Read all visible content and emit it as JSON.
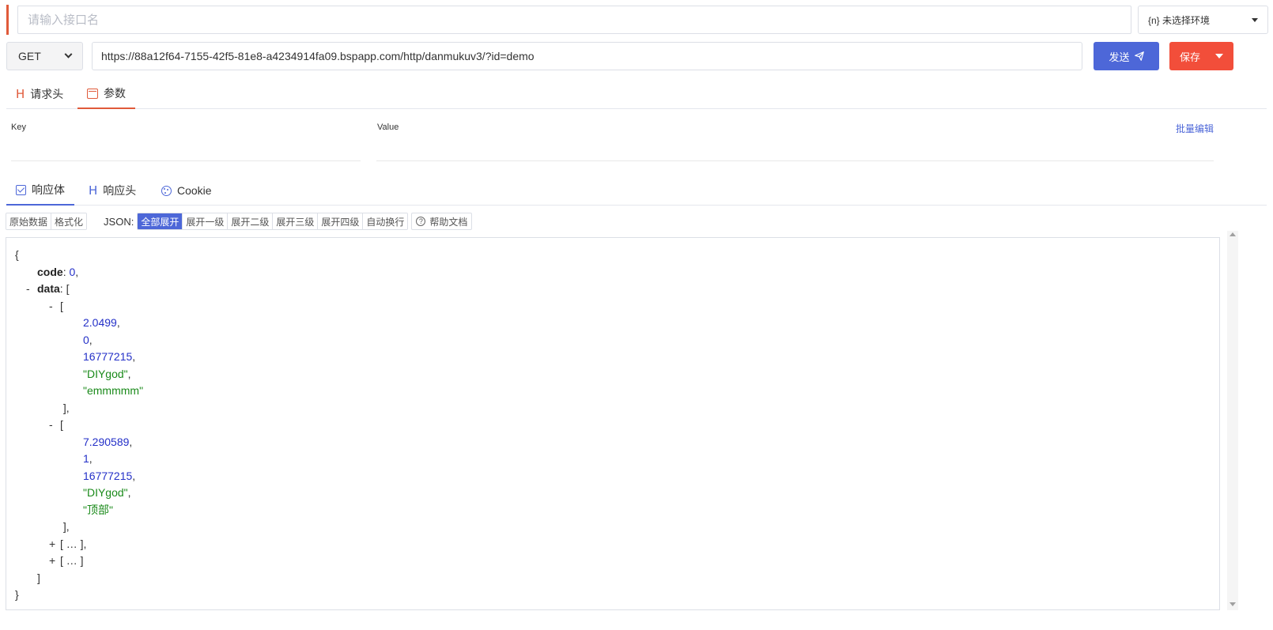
{
  "header": {
    "name_placeholder": "请输入接口名",
    "env_label": "{n} 未选择环境"
  },
  "request": {
    "method": "GET",
    "url": "https://88a12f64-7155-42f5-81e8-a4234914fa09.bspapp.com/http/danmukuv3/?id=demo",
    "send_label": "发送",
    "save_label": "保存"
  },
  "request_tabs": [
    {
      "label": "请求头",
      "icon": "h-icon"
    },
    {
      "label": "参数",
      "icon": "params-icon"
    }
  ],
  "params": {
    "key_header": "Key",
    "value_header": "Value",
    "bulk_edit": "批量编辑"
  },
  "response_tabs": [
    {
      "label": "响应体",
      "icon": "check-icon"
    },
    {
      "label": "响应头",
      "icon": "h-icon"
    },
    {
      "label": "Cookie",
      "icon": "cookie-icon"
    }
  ],
  "toolbar": {
    "view_buttons": [
      "原始数据",
      "格式化"
    ],
    "json_label": "JSON:",
    "expand_buttons": [
      "全部展开",
      "展开一级",
      "展开二级",
      "展开三级",
      "展开四级",
      "自动换行"
    ],
    "active_expand": "全部展开",
    "help_label": "帮助文档"
  },
  "json_lines": [
    {
      "indent": 0,
      "toggle": "",
      "parts": [
        {
          "t": "p",
          "v": "{"
        }
      ]
    },
    {
      "indent": 1,
      "toggle": "",
      "parts": [
        {
          "t": "k",
          "v": "code"
        },
        {
          "t": "p",
          "v": ": "
        },
        {
          "t": "n",
          "v": "0"
        },
        {
          "t": "p",
          "v": ","
        }
      ]
    },
    {
      "indent": 1,
      "toggle": "-",
      "parts": [
        {
          "t": "k",
          "v": "data"
        },
        {
          "t": "p",
          "v": ": ["
        }
      ]
    },
    {
      "indent": 2,
      "toggle": "-",
      "parts": [
        {
          "t": "p",
          "v": "["
        }
      ]
    },
    {
      "indent": 3,
      "toggle": "",
      "parts": [
        {
          "t": "n",
          "v": "2.0499"
        },
        {
          "t": "p",
          "v": ","
        }
      ]
    },
    {
      "indent": 3,
      "toggle": "",
      "parts": [
        {
          "t": "n",
          "v": "0"
        },
        {
          "t": "p",
          "v": ","
        }
      ]
    },
    {
      "indent": 3,
      "toggle": "",
      "parts": [
        {
          "t": "n",
          "v": "16777215"
        },
        {
          "t": "p",
          "v": ","
        }
      ]
    },
    {
      "indent": 3,
      "toggle": "",
      "parts": [
        {
          "t": "s",
          "v": "\"DIYgod\""
        },
        {
          "t": "p",
          "v": ","
        }
      ]
    },
    {
      "indent": 3,
      "toggle": "",
      "parts": [
        {
          "t": "s",
          "v": "\"emmmmm\""
        }
      ]
    },
    {
      "indent": 2,
      "toggle": "",
      "parts": [
        {
          "t": "p",
          "v": " ],"
        }
      ]
    },
    {
      "indent": 2,
      "toggle": "-",
      "parts": [
        {
          "t": "p",
          "v": "["
        }
      ]
    },
    {
      "indent": 3,
      "toggle": "",
      "parts": [
        {
          "t": "n",
          "v": "7.290589"
        },
        {
          "t": "p",
          "v": ","
        }
      ]
    },
    {
      "indent": 3,
      "toggle": "",
      "parts": [
        {
          "t": "n",
          "v": "1"
        },
        {
          "t": "p",
          "v": ","
        }
      ]
    },
    {
      "indent": 3,
      "toggle": "",
      "parts": [
        {
          "t": "n",
          "v": "16777215"
        },
        {
          "t": "p",
          "v": ","
        }
      ]
    },
    {
      "indent": 3,
      "toggle": "",
      "parts": [
        {
          "t": "s",
          "v": "\"DIYgod\""
        },
        {
          "t": "p",
          "v": ","
        }
      ]
    },
    {
      "indent": 3,
      "toggle": "",
      "parts": [
        {
          "t": "s",
          "v": "\"顶部\""
        }
      ]
    },
    {
      "indent": 2,
      "toggle": "",
      "parts": [
        {
          "t": "p",
          "v": " ],"
        }
      ]
    },
    {
      "indent": 2,
      "toggle": "+",
      "parts": [
        {
          "t": "p",
          "v": "[ … ],"
        }
      ]
    },
    {
      "indent": 2,
      "toggle": "+",
      "parts": [
        {
          "t": "p",
          "v": "[ … ]"
        }
      ]
    },
    {
      "indent": 1,
      "toggle": "",
      "parts": [
        {
          "t": "p",
          "v": "]"
        }
      ]
    },
    {
      "indent": 0,
      "toggle": "",
      "parts": [
        {
          "t": "p",
          "v": "}"
        }
      ]
    }
  ]
}
